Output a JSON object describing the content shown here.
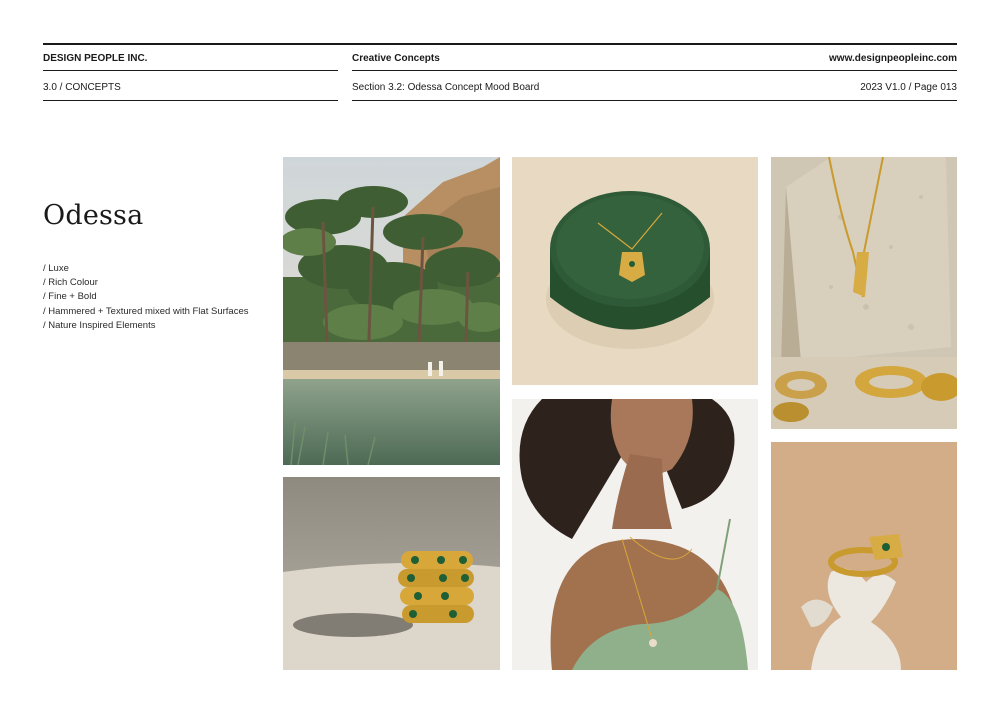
{
  "header": {
    "company": "DESIGN PEOPLE INC.",
    "section_label": "Creative Concepts",
    "website": "www.designpeopleinc.com",
    "chapter": "3.0 / CONCEPTS",
    "subsection": "Section 3.2: Odessa Concept Mood Board",
    "version_page": "2023 V1.0 / Page 013"
  },
  "concept": {
    "title": "Odessa",
    "attributes": [
      "/ Luxe",
      "/ Rich Colour",
      "/ Fine + Bold",
      "/ Hammered + Textured mixed with Flat Surfaces",
      "/ Nature Inspired Elements"
    ]
  },
  "palette": {
    "oasis_green": "#5b7a5a",
    "velvet_green": "#2f5a37",
    "gold": "#d7a73a",
    "beige": "#e6d6bf",
    "sage_satin": "#8fb08a",
    "tan": "#d2ad88"
  }
}
